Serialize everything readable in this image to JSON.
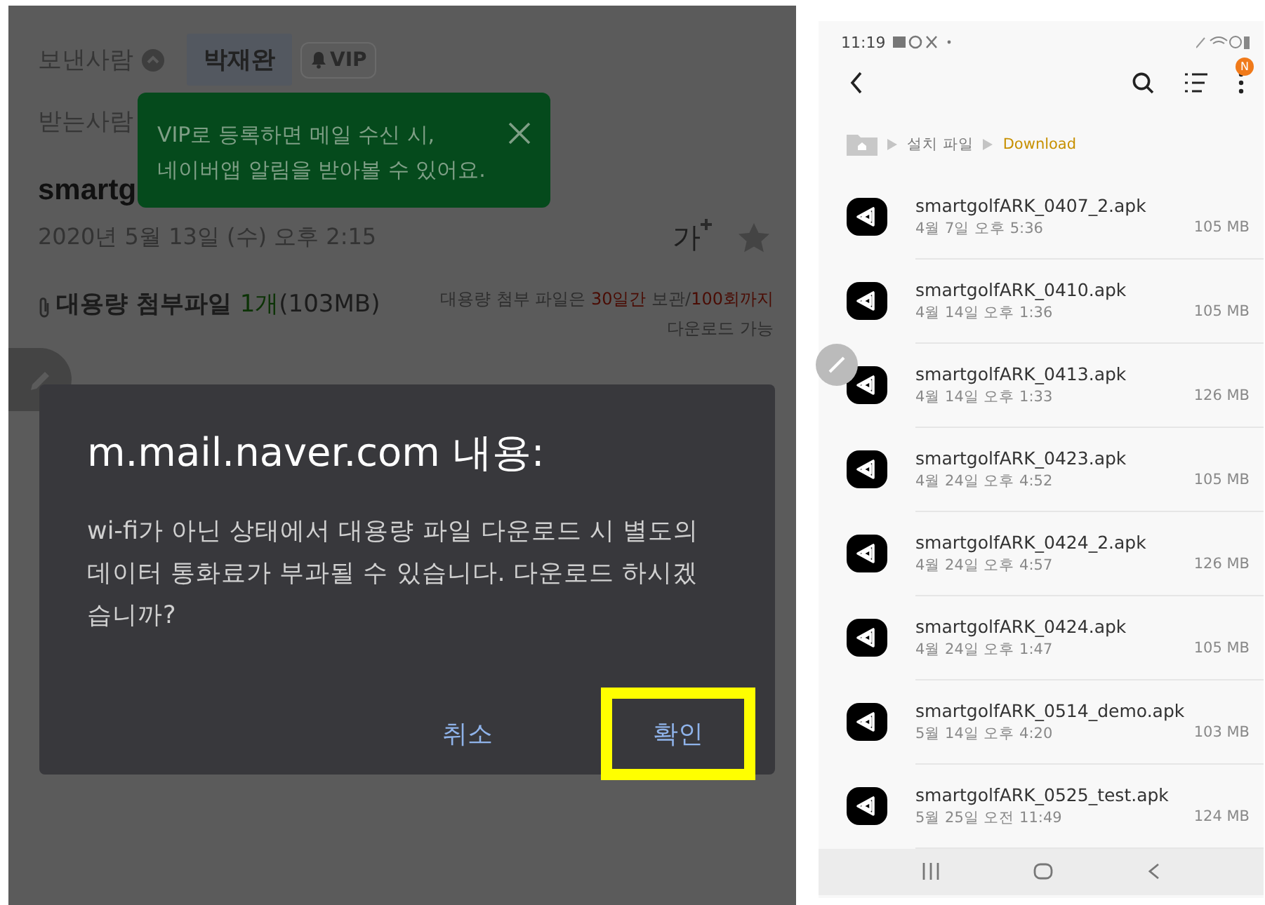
{
  "mail": {
    "sender_label": "보낸사람",
    "sender_name": "박재완",
    "vip_tag": "VIP",
    "recipient_label": "받는사람",
    "subject": "smartg",
    "date": "2020년 5월 13일 (수) 오후 2:15",
    "font_size_label": "가",
    "attachment": [
      {
        "text": "대용량 첨부파일 ",
        "kind": "strong"
      },
      {
        "text": "1개",
        "kind": "count"
      },
      {
        "text": "(103MB)",
        "kind": "plain"
      }
    ],
    "notice": [
      {
        "text": "대용량 첨부 파일은 ",
        "kind": "plain"
      },
      {
        "text": "30일간",
        "kind": "accent"
      },
      {
        "text": " 보관/",
        "kind": "plain"
      },
      {
        "text": "100회까지",
        "kind": "accent"
      }
    ],
    "notice_line2": "다운로드 가능"
  },
  "tooltip": {
    "lines": [
      "VIP로 등록하면 메일 수신 시,",
      "네이버앱 알림을 받아볼 수 있어요."
    ]
  },
  "dialog": {
    "title": "m.mail.naver.com 내용:",
    "message": "wi-fi가 아닌 상태에서 대용량 파일 다운로드 시 별도의 데이터 통화료가 부과될 수 있습니다. 다운로드 하시겠습니까?",
    "buttons": [
      {
        "label": "취소",
        "highlighted": false
      },
      {
        "label": "확인",
        "highlighted": true
      }
    ]
  },
  "file_manager": {
    "status_time": "11:19",
    "badge": "N",
    "breadcrumb": [
      "설치 파일",
      "Download"
    ],
    "files": [
      {
        "name": "smartgolfARK_0407_2.apk",
        "date": "4월 7일 오후 5:36",
        "size": "105 MB"
      },
      {
        "name": "smartgolfARK_0410.apk",
        "date": "4월 14일 오후 1:36",
        "size": "105 MB"
      },
      {
        "name": "smartgolfARK_0413.apk",
        "date": "4월 14일 오후 1:33",
        "size": "126 MB"
      },
      {
        "name": "smartgolfARK_0423.apk",
        "date": "4월 24일 오후 4:52",
        "size": "105 MB"
      },
      {
        "name": "smartgolfARK_0424_2.apk",
        "date": "4월 24일 오후 4:57",
        "size": "126 MB"
      },
      {
        "name": "smartgolfARK_0424.apk",
        "date": "4월 24일 오후 1:47",
        "size": "105 MB"
      },
      {
        "name": "smartgolfARK_0514_demo.apk",
        "date": "5월 14일 오후 4:20",
        "size": "103 MB"
      },
      {
        "name": "smartgolfARK_0525_test.apk",
        "date": "5월 25일 오전 11:49",
        "size": "124 MB"
      }
    ]
  }
}
